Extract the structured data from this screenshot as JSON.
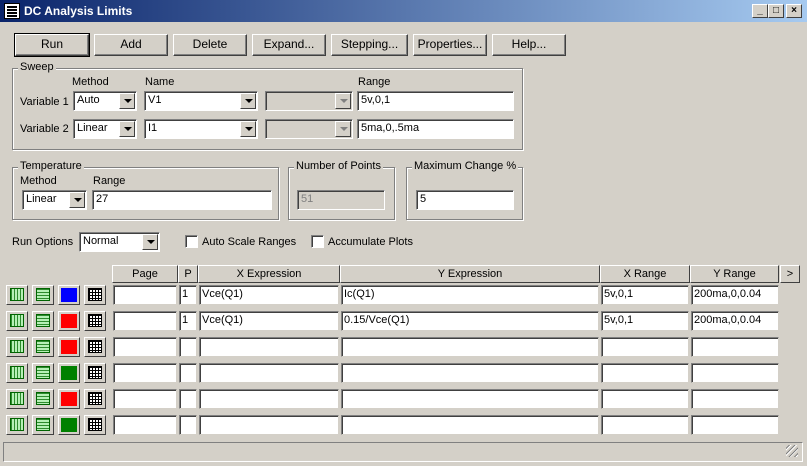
{
  "window": {
    "title": "DC Analysis Limits",
    "minimize": "_",
    "maximize": "□",
    "close": "×"
  },
  "toolbar": {
    "buttons": [
      {
        "id": "run",
        "label": "Run",
        "accel": "R"
      },
      {
        "id": "add",
        "label": "Add",
        "accel": "A"
      },
      {
        "id": "delete",
        "label": "Delete",
        "accel": "D"
      },
      {
        "id": "expand",
        "label": "Expand...",
        "accel": "x"
      },
      {
        "id": "stepping",
        "label": "Stepping...",
        "accel": "S"
      },
      {
        "id": "properties",
        "label": "Properties...",
        "accel": "P"
      },
      {
        "id": "help",
        "label": "Help...",
        "accel": "H"
      }
    ]
  },
  "sweep": {
    "title": "Sweep",
    "col_method": "Method",
    "col_name": "Name",
    "col_range": "Range",
    "rows": [
      {
        "label": "Variable 1",
        "method": "Auto",
        "name": "V1",
        "extra": "",
        "range": "5v,0,1"
      },
      {
        "label": "Variable 2",
        "method": "Linear",
        "name": "I1",
        "extra": "",
        "range": "5ma,0,.5ma"
      }
    ]
  },
  "temperature": {
    "title": "Temperature",
    "method_label": "Method",
    "range_label": "Range",
    "method": "Linear",
    "range": "27"
  },
  "points": {
    "title": "Number of Points",
    "value": "51"
  },
  "maxchange": {
    "title": "Maximum Change %",
    "value": "5"
  },
  "run_options": {
    "label": "Run Options",
    "value": "Normal"
  },
  "options": {
    "auto_scale": "Auto Scale Ranges",
    "accumulate": "Accumulate Plots"
  },
  "grid": {
    "headers": {
      "page": "Page",
      "p": "P",
      "x_expr": "X Expression",
      "y_expr": "Y Expression",
      "x_range": "X Range",
      "y_range": "Y Range",
      "more": ">"
    },
    "rows": [
      {
        "color": "#0000ff",
        "page": "",
        "p": "1",
        "x_expr": "Vce(Q1)",
        "y_expr": "Ic(Q1)",
        "x_range": "5v,0,1",
        "y_range": "200ma,0,0.04"
      },
      {
        "color": "#ff0000",
        "page": "",
        "p": "1",
        "x_expr": "Vce(Q1)",
        "y_expr": "0.15/Vce(Q1)",
        "x_range": "5v,0,1",
        "y_range": "200ma,0,0.04"
      },
      {
        "color": "#ff0000",
        "page": "",
        "p": "",
        "x_expr": "",
        "y_expr": "",
        "x_range": "",
        "y_range": ""
      },
      {
        "color": "#008000",
        "page": "",
        "p": "",
        "x_expr": "",
        "y_expr": "",
        "x_range": "",
        "y_range": ""
      },
      {
        "color": "#ff0000",
        "page": "",
        "p": "",
        "x_expr": "",
        "y_expr": "",
        "x_range": "",
        "y_range": ""
      },
      {
        "color": "#008000",
        "page": "",
        "p": "",
        "x_expr": "",
        "y_expr": "",
        "x_range": "",
        "y_range": ""
      }
    ]
  }
}
